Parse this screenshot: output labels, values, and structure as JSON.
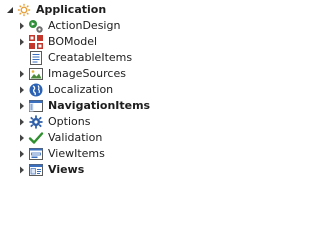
{
  "tree": {
    "root": {
      "label": "Application",
      "icon": "gear-icon",
      "expanded": true
    },
    "children": [
      {
        "label": "ActionDesign",
        "icon": "actions-icon",
        "bold": false,
        "expandable": true
      },
      {
        "label": "BOModel",
        "icon": "bo-model-icon",
        "bold": false,
        "expandable": true
      },
      {
        "label": "CreatableItems",
        "icon": "list-document-icon",
        "bold": false,
        "expandable": false
      },
      {
        "label": "ImageSources",
        "icon": "image-icon",
        "bold": false,
        "expandable": true
      },
      {
        "label": "Localization",
        "icon": "globe-icon",
        "bold": false,
        "expandable": true
      },
      {
        "label": "NavigationItems",
        "icon": "navigation-icon",
        "bold": true,
        "expandable": true
      },
      {
        "label": "Options",
        "icon": "gear-icon",
        "bold": false,
        "expandable": true
      },
      {
        "label": "Validation",
        "icon": "checkmark-icon",
        "bold": false,
        "expandable": true
      },
      {
        "label": "ViewItems",
        "icon": "view-items-icon",
        "bold": false,
        "expandable": true
      },
      {
        "label": "Views",
        "icon": "views-icon",
        "bold": true,
        "expandable": true
      }
    ]
  }
}
